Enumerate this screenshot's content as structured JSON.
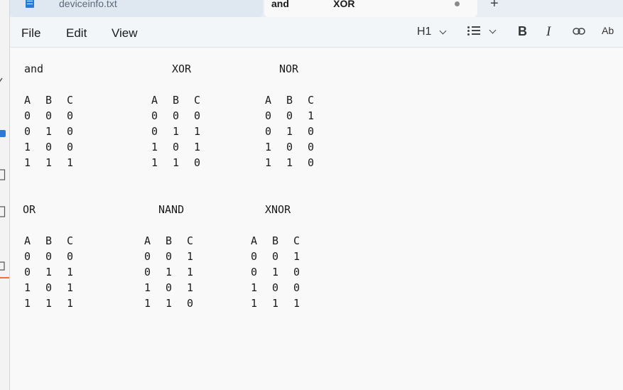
{
  "tabs": [
    {
      "label": "deviceinfo.txt"
    },
    {
      "label": "and                XOR"
    }
  ],
  "new_tab": "+",
  "menu": {
    "file": "File",
    "edit": "Edit",
    "view": "View"
  },
  "toolbar": {
    "heading": "H1",
    "bold": "B",
    "italic": "I",
    "spellcheck": "Ab"
  },
  "tables": {
    "and": {
      "title": "and",
      "header": [
        "A",
        "B",
        "C"
      ],
      "rows": [
        [
          "0",
          "0",
          "0"
        ],
        [
          "0",
          "1",
          "0"
        ],
        [
          "1",
          "0",
          "0"
        ],
        [
          "1",
          "1",
          "1"
        ]
      ]
    },
    "xor": {
      "title": "XOR",
      "header": [
        "A",
        "B",
        "C"
      ],
      "rows": [
        [
          "0",
          "0",
          "0"
        ],
        [
          "0",
          "1",
          "1"
        ],
        [
          "1",
          "0",
          "1"
        ],
        [
          "1",
          "1",
          "0"
        ]
      ]
    },
    "nor": {
      "title": "NOR",
      "header": [
        "A",
        "B",
        "C"
      ],
      "rows": [
        [
          "0",
          "0",
          "1"
        ],
        [
          "0",
          "1",
          "0"
        ],
        [
          "1",
          "0",
          "0"
        ],
        [
          "1",
          "1",
          "0"
        ]
      ]
    },
    "or": {
      "title": "OR",
      "header": [
        "A",
        "B",
        "C"
      ],
      "rows": [
        [
          "0",
          "0",
          "0"
        ],
        [
          "0",
          "1",
          "1"
        ],
        [
          "1",
          "0",
          "1"
        ],
        [
          "1",
          "1",
          "1"
        ]
      ]
    },
    "nand": {
      "title": "NAND",
      "header": [
        "A",
        "B",
        "C"
      ],
      "rows": [
        [
          "0",
          "0",
          "1"
        ],
        [
          "0",
          "1",
          "1"
        ],
        [
          "1",
          "0",
          "1"
        ],
        [
          "1",
          "1",
          "0"
        ]
      ]
    },
    "xnor": {
      "title": "XNOR",
      "header": [
        "A",
        "B",
        "C"
      ],
      "rows": [
        [
          "0",
          "0",
          "1"
        ],
        [
          "0",
          "1",
          "0"
        ],
        [
          "1",
          "0",
          "0"
        ],
        [
          "1",
          "1",
          "1"
        ]
      ]
    }
  }
}
